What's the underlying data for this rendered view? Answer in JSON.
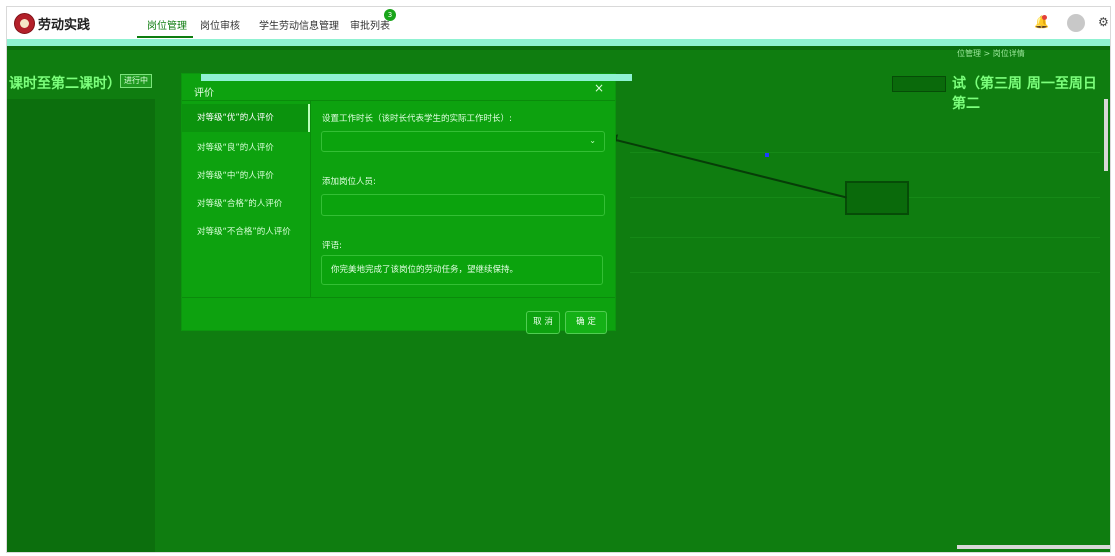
{
  "app": {
    "title": "劳动实践",
    "nav": [
      "岗位管理",
      "岗位审核",
      "学生劳动信息管理",
      "审批列表"
    ],
    "badge_count": "3"
  },
  "background": {
    "title_left": "课时至第二课时）",
    "status_tag": "进行中",
    "breadcrumb": "位管理 > 岗位详情",
    "title_right": "试（第三周 周一至周日 第二"
  },
  "dialog": {
    "title": "评价",
    "close_symbol": "×",
    "sidebar_items": [
      "对等级“优”的人评价",
      "对等级“良”的人评价",
      "对等级“中”的人评价",
      "对等级“合格”的人评价",
      "对等级“不合格”的人评价"
    ],
    "work_time_label": "设置工作时长（该时长代表学生的实际工作时长）:",
    "add_staff_label": "添加岗位人员:",
    "comment_label": "评语:",
    "comment_value": "你完美地完成了该岗位的劳动任务，望继续保持。",
    "cancel_label": "取 消",
    "confirm_label": "确 定"
  }
}
